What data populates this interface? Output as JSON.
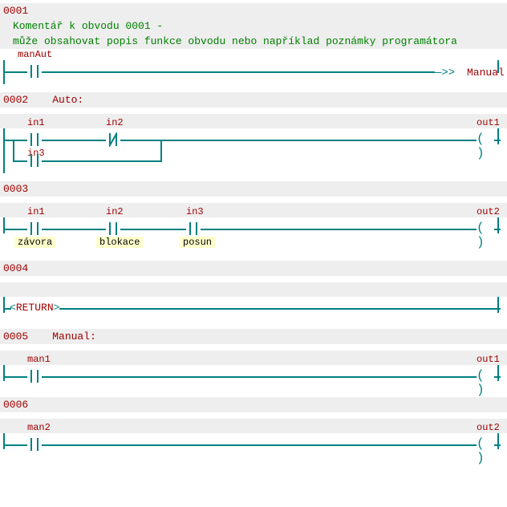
{
  "r1": {
    "num": "0001",
    "c1": "Komentář k obvodu 0001 -",
    "c2": "může obsahovat popis funkce obvodu nebo například poznámky programátora",
    "i1": "manAut",
    "j": "Manual"
  },
  "r2": {
    "num": "0002",
    "label": "Auto:",
    "i1": "in1",
    "i2": "in2",
    "i3": "in3",
    "o": "out1"
  },
  "r3": {
    "num": "0003",
    "i1": "in1",
    "i2": "in2",
    "i3": "in3",
    "o": "out2",
    "d1": "závora",
    "d2": "blokace",
    "d3": "posun"
  },
  "r4": {
    "num": "0004",
    "ret": "RETURN"
  },
  "r5": {
    "num": "0005",
    "label": "Manual:",
    "i1": "man1",
    "o": "out1"
  },
  "r6": {
    "num": "0006",
    "i1": "man2",
    "o": "out2"
  }
}
